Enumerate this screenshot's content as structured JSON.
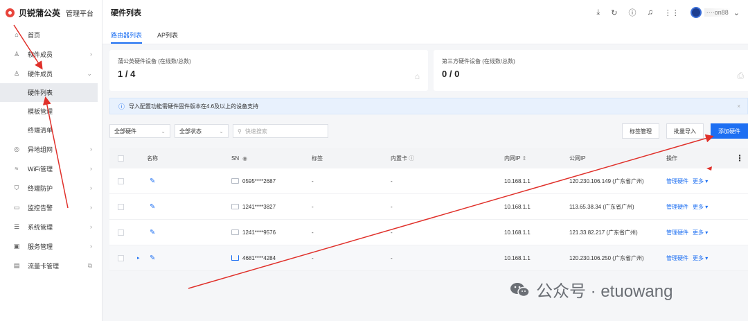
{
  "brand": {
    "name": "贝锐蒲公英",
    "sub": "管理平台"
  },
  "nav": [
    {
      "label": "首页",
      "icon": "home-icon",
      "glyph": "⌂",
      "chevron": ""
    },
    {
      "label": "软件成员",
      "icon": "user-icon",
      "glyph": "♙",
      "chevron": "›"
    },
    {
      "label": "硬件成员",
      "icon": "hardware-user-icon",
      "glyph": "♙",
      "chevron": "⌄"
    }
  ],
  "nav_sub": [
    "硬件列表",
    "模板管理",
    "终端清单"
  ],
  "nav2": [
    {
      "label": "异地组网",
      "icon": "network-icon",
      "glyph": "◎",
      "chevron": "›"
    },
    {
      "label": "WiFi管理",
      "icon": "wifi-icon",
      "glyph": "≈",
      "chevron": "›"
    },
    {
      "label": "终端防护",
      "icon": "shield-icon",
      "glyph": "⛉",
      "chevron": "›"
    },
    {
      "label": "监控告警",
      "icon": "monitor-icon",
      "glyph": "▭",
      "chevron": "›"
    },
    {
      "label": "系统管理",
      "icon": "settings-icon",
      "glyph": "☰",
      "chevron": "›"
    },
    {
      "label": "服务管理",
      "icon": "service-icon",
      "glyph": "▣",
      "chevron": "›"
    },
    {
      "label": "流量卡管理",
      "icon": "sim-card-icon",
      "glyph": "▤",
      "chevron": "⧉"
    }
  ],
  "header": {
    "title": "硬件列表",
    "user": "····on88"
  },
  "tabs": [
    "路由器列表",
    "AP列表"
  ],
  "cards": [
    {
      "label": "蒲公英硬件设备 (在线数/总数)",
      "value": "1 / 4",
      "icon": "router-icon"
    },
    {
      "label": "第三方硬件设备 (在线数/总数)",
      "value": "0 / 0",
      "icon": "printer-icon"
    }
  ],
  "notice": "导入配置功能需硬件固件版本在4.6及以上的设备支持",
  "filters": {
    "type": "全部硬件",
    "status": "全部状态",
    "search_placeholder": "快速搜索"
  },
  "buttons": {
    "tags": "标签管理",
    "import": "批量导入",
    "add": "添加硬件"
  },
  "columns": {
    "name": "名称",
    "sn": "SN",
    "tag": "标签",
    "sim": "内置卡",
    "lan": "内网IP",
    "wan": "公网IP",
    "op": "操作"
  },
  "rows": [
    {
      "sn": "0595****2687",
      "tag": "-",
      "sim": "-",
      "lan": "10.168.1.1",
      "wan": "120.230.106.149 (广东省广州)",
      "manage": "管理硬件",
      "more": "更多"
    },
    {
      "sn": "1241****3827",
      "tag": "-",
      "sim": "-",
      "lan": "10.168.1.1",
      "wan": "113.65.38.34 (广东省广州)",
      "manage": "管理硬件",
      "more": "更多"
    },
    {
      "sn": "1241****9576",
      "tag": "-",
      "sim": "-",
      "lan": "10.168.1.1",
      "wan": "121.33.82.217 (广东省广州)",
      "manage": "管理硬件",
      "more": "更多"
    },
    {
      "sn": "4681****4284",
      "tag": "-",
      "sim": "-",
      "lan": "10.168.1.1",
      "wan": "120.230.106.250 (广东省广州)",
      "manage": "管理硬件",
      "more": "更多"
    }
  ],
  "watermark": "公众号 · etuowang",
  "colors": {
    "accent": "#1d6ff2",
    "annotation": "#e0302a"
  }
}
